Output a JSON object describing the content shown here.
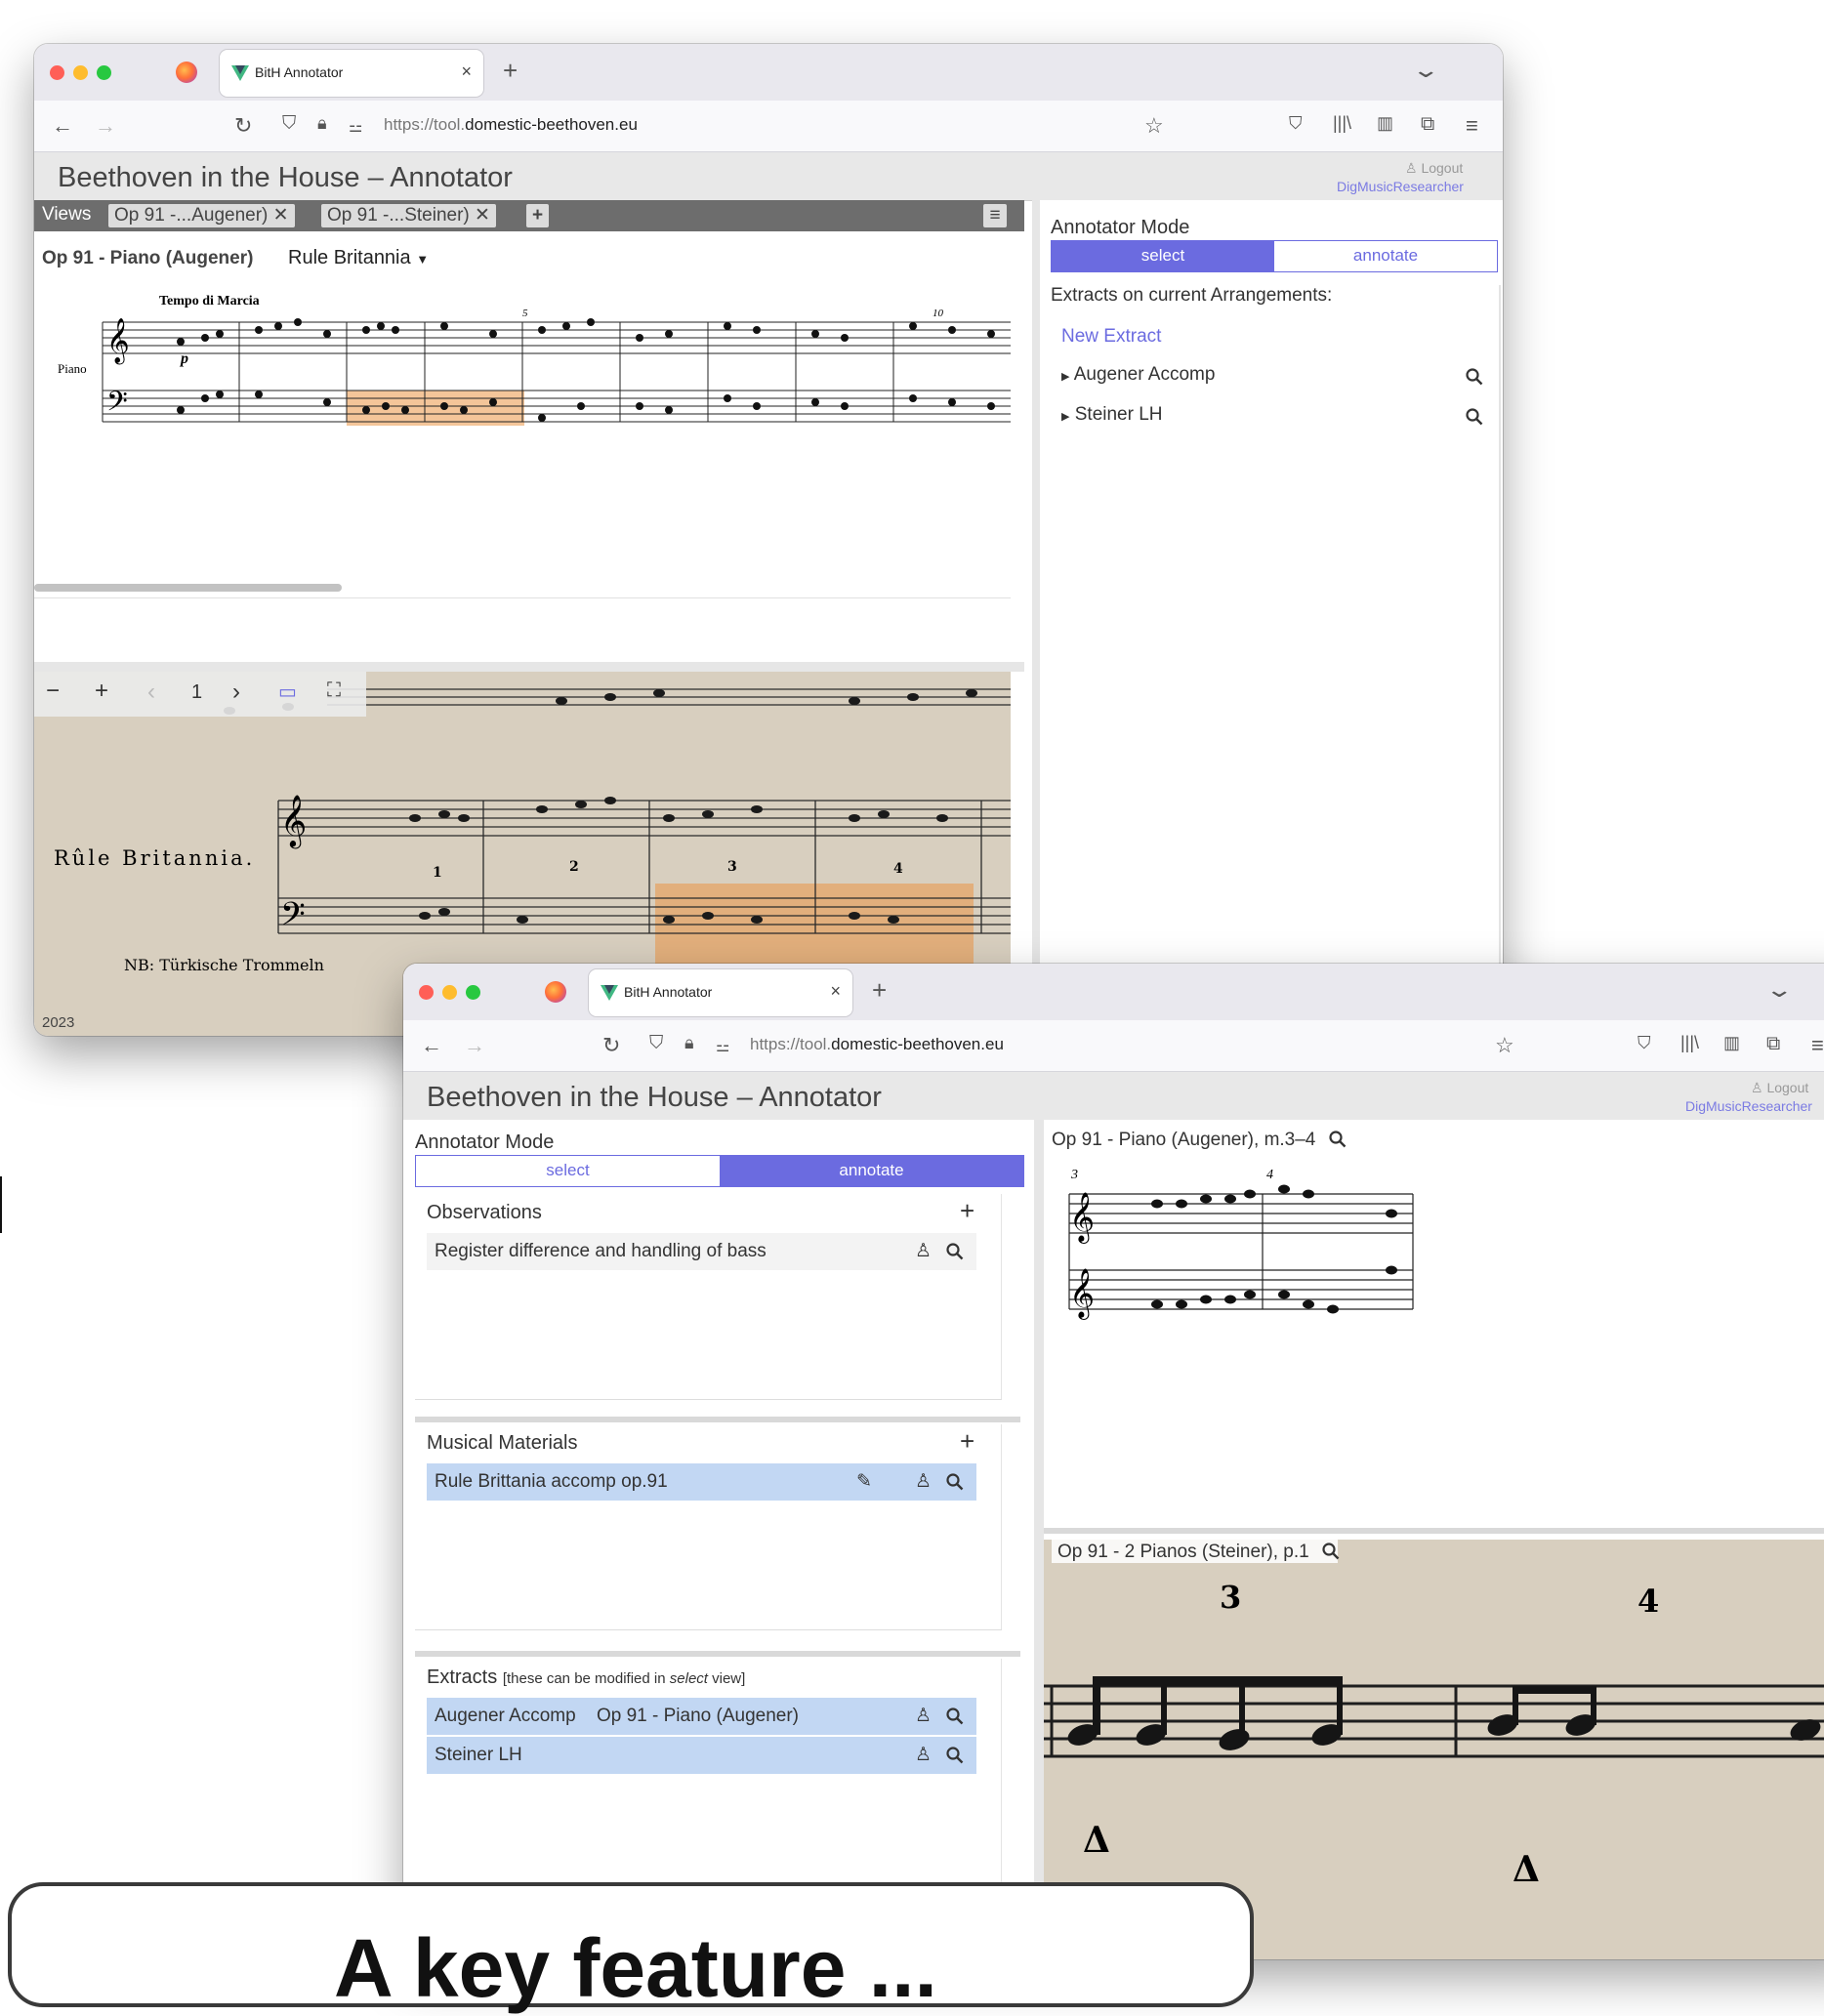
{
  "browser": {
    "tab_title": "BitH Annotator",
    "url_prefix": "https://tool.",
    "url_domain": "domestic-beethoven.eu"
  },
  "app": {
    "title": "Beethoven in the House – Annotator",
    "logout_label": "Logout",
    "username": "DigMusicResearcher"
  },
  "window1": {
    "views_label": "Views",
    "view_tabs": [
      "Op 91 -...Augener) ✕",
      "Op 91 -...Steiner) ✕"
    ],
    "score_title": "Op 91 - Piano (Augener)",
    "selector_value": "Rule Britannia",
    "tempo_label": "Tempo di Marcia",
    "instrument_label": "Piano",
    "dynamic_label": "p",
    "measure_numbers": [
      "5",
      "10"
    ],
    "viewer_page": "1",
    "facsimile_title": "Rûle Britannia.",
    "facsimile_note": "NB: Türkische Trommeln",
    "facsimile_measure_numbers": [
      "1",
      "2",
      "3",
      "4"
    ],
    "year": "2023",
    "annotator_mode_label": "Annotator Mode",
    "mode_options": [
      "select",
      "annotate"
    ],
    "active_mode": "select",
    "extracts_heading": "Extracts on current Arrangements:",
    "new_extract_label": "New Extract",
    "extracts": [
      "Augener Accomp",
      "Steiner LH"
    ]
  },
  "window2": {
    "annotator_mode_label": "Annotator Mode",
    "mode_options": [
      "select",
      "annotate"
    ],
    "active_mode": "annotate",
    "observations_heading": "Observations",
    "observations": [
      "Register difference and handling of bass"
    ],
    "materials_heading": "Musical Materials",
    "materials": [
      "Rule Brittania accomp op.91"
    ],
    "extracts_heading": "Extracts",
    "extracts_note_pre": "[these can be modified in ",
    "extracts_note_em": "select",
    "extracts_note_post": " view]",
    "extracts": [
      {
        "name": "Augener Accomp",
        "source": "Op 91 - Piano (Augener)"
      },
      {
        "name": "Steiner LH",
        "source": ""
      }
    ],
    "preview1_title": "Op 91 - Piano (Augener), m.3–4",
    "preview1_measure_numbers": [
      "3",
      "4"
    ],
    "preview2_title": "Op 91 - 2 Pianos (Steiner), p.1",
    "preview2_measure_numbers": [
      "3",
      "4"
    ]
  },
  "callout_text": "A key feature ...",
  "colors": {
    "accent": "#6b6be0",
    "selected_row": "#c2d7f3",
    "highlight": "#eb9646",
    "paper": "#d8cfbf"
  }
}
